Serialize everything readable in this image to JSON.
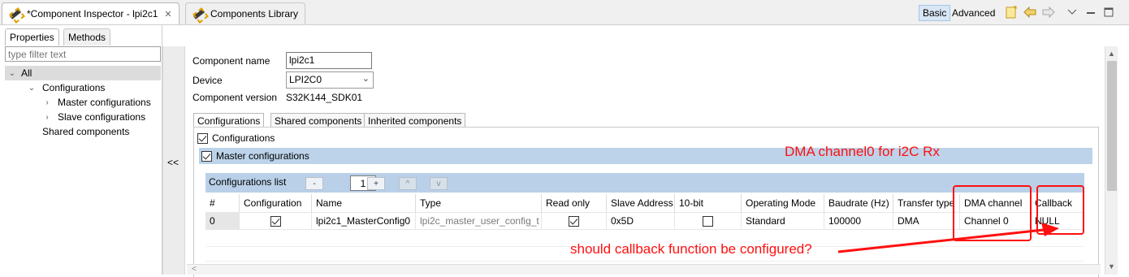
{
  "topbar": {
    "tabs": [
      {
        "label": "*Component Inspector - lpi2c1",
        "close": "✕"
      },
      {
        "label": "Components Library"
      }
    ],
    "view_modes": [
      "Basic",
      "Advanced"
    ],
    "selected_mode": "Basic"
  },
  "left": {
    "tabs": [
      "Properties",
      "Methods"
    ],
    "filter_placeholder": "type filter text",
    "tree": [
      {
        "label": "All",
        "expander": "⌄"
      },
      {
        "label": "Configurations",
        "expander": "⌄"
      },
      {
        "label": "Master configurations",
        "expander": "›"
      },
      {
        "label": "Slave configurations",
        "expander": "›"
      },
      {
        "label": "Shared components",
        "expander": ""
      }
    ],
    "collapse": "<<"
  },
  "main": {
    "component_name_label": "Component name",
    "component_name_value": "lpi2c1",
    "device_label": "Device",
    "device_value": "LPI2C0",
    "version_label": "Component version",
    "version_value": "S32K144_SDK01",
    "tabs": [
      "Configurations",
      "Shared components",
      "Inherited components"
    ],
    "configurations_checkbox": "Configurations",
    "master_configurations": "Master configurations",
    "configurations_list": "Configurations list",
    "list_buttons": [
      "-",
      "+",
      "^",
      "v"
    ],
    "page": "1",
    "table": {
      "headers": [
        "#",
        "Configuration",
        "Name",
        "Type",
        "Read only",
        "Slave Address",
        "10-bit",
        "Operating Mode",
        "Baudrate (Hz)",
        "Transfer type",
        "DMA channel",
        "Callback"
      ],
      "row": {
        "index": "0",
        "configuration_checked": true,
        "name": "lpi2c1_MasterConfig0",
        "type": "lpi2c_master_user_config_t",
        "read_only_checked": true,
        "slave_address": "0x5D",
        "ten_bit_checked": false,
        "operating_mode": "Standard",
        "baudrate": "100000",
        "transfer_type": "DMA",
        "dma_channel": "Channel 0",
        "callback": "NULL"
      }
    }
  },
  "annotations": {
    "dma_note": "DMA channel0 for i2C Rx",
    "callback_note": "should callback function be configured?",
    "color": "#ff1010"
  },
  "colors": {
    "selected_band": "#bcd3ea",
    "list_band": "#b9d0e8"
  }
}
